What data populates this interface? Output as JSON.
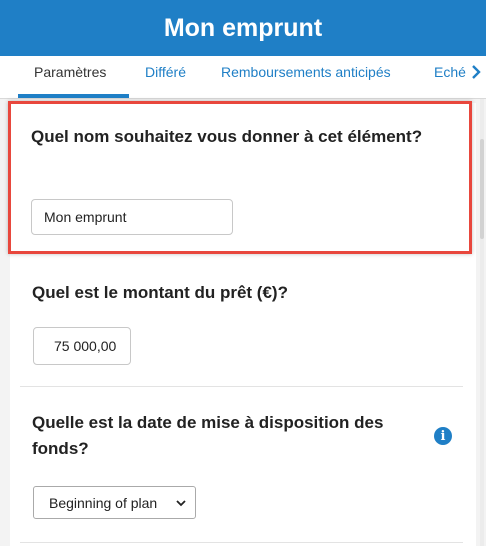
{
  "header": {
    "title": "Mon emprunt"
  },
  "tabs": [
    {
      "label": "Paramètres",
      "active": true
    },
    {
      "label": "Différé"
    },
    {
      "label": "Remboursements anticipés"
    },
    {
      "label": "Eché"
    }
  ],
  "tabs_next_icon": "chevron-right",
  "fields": {
    "name": {
      "question": "Quel nom souhaitez vous donner à cet élément?",
      "value": "Mon emprunt"
    },
    "amount": {
      "question": "Quel est le montant du prêt (€)?",
      "value": "75 000,00"
    },
    "date": {
      "question": "Quelle est la date de mise à disposition des fonds?",
      "selected": "Beginning of plan",
      "info_icon": "info-icon"
    }
  },
  "colors": {
    "accent": "#1f7fc6",
    "highlight_border": "#e8473d",
    "page_background": "#f3f3f3"
  }
}
